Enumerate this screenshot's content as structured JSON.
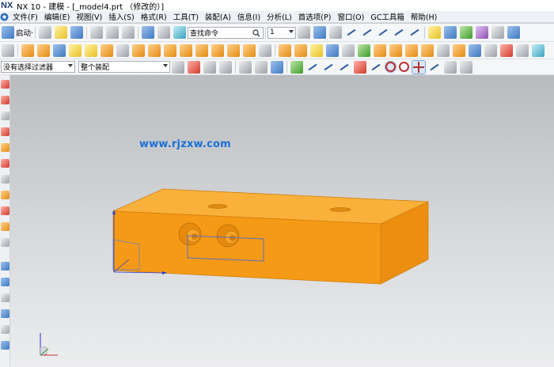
{
  "app": {
    "logo": "NX",
    "title": "NX 10 - 建模 - [_model4.prt （修改的）]"
  },
  "menu": {
    "items": [
      "文件(F)",
      "编辑(E)",
      "视图(V)",
      "插入(S)",
      "格式(R)",
      "工具(T)",
      "装配(A)",
      "信息(I)",
      "分析(L)",
      "首选项(P)",
      "窗口(O)",
      "GC工具箱",
      "帮助(H)"
    ]
  },
  "toolbar1": {
    "start_label": "启动·",
    "command_search_placeholder": "查找命令",
    "layer_value": "1"
  },
  "toolbar3": {
    "filter_value": "没有选择过滤器",
    "scope_value": "整个装配"
  },
  "viewport": {
    "watermark": "www.rjzxw.com",
    "model_color": "#f7a11b",
    "background_top": "#b9bcbf",
    "background_bottom": "#ecedee"
  }
}
